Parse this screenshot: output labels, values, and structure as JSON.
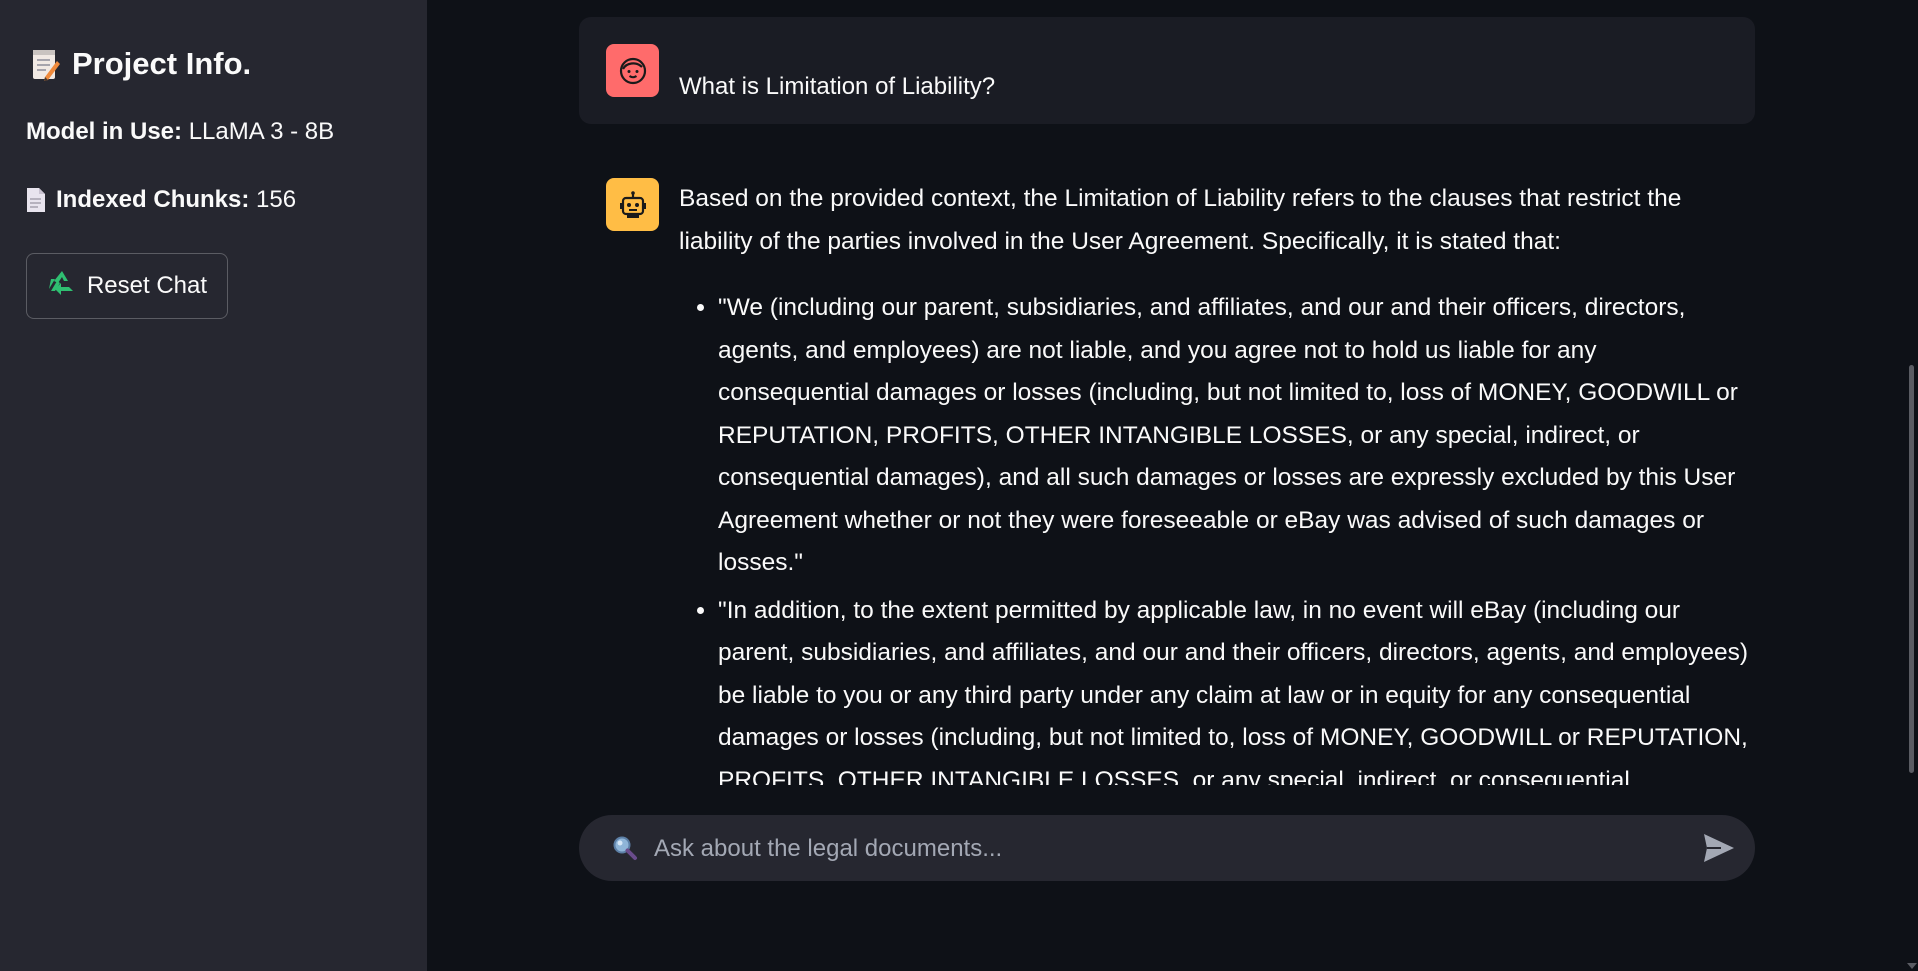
{
  "sidebar": {
    "title": "Project Info.",
    "title_icon": "memo-icon",
    "model_label": "Model in Use:",
    "model_value": "LLaMA 3 - 8B",
    "chunks_icon": "page-icon",
    "chunks_label": "Indexed Chunks:",
    "chunks_value": "156",
    "reset_icon": "recycle-icon",
    "reset_label": "Reset Chat"
  },
  "chat": {
    "messages": [
      {
        "role": "user",
        "avatar_icon": "user-face-icon",
        "avatar_color": "#ff6b6b",
        "text": "What is Limitation of Liability?"
      },
      {
        "role": "assistant",
        "avatar_icon": "robot-icon",
        "avatar_color": "#ffbd45",
        "intro": "Based on the provided context, the Limitation of Liability refers to the clauses that restrict the liability of the parties involved in the User Agreement. Specifically, it is stated that:",
        "bullets": [
          "\"We (including our parent, subsidiaries, and affiliates, and our and their officers, directors, agents, and employees) are not liable, and you agree not to hold us liable for any consequential damages or losses (including, but not limited to, loss of MONEY, GOODWILL or REPUTATION, PROFITS, OTHER INTANGIBLE LOSSES, or any special, indirect, or consequential damages), and all such damages or losses are expressly excluded by this User Agreement whether or not they were foreseeable or eBay was advised of such damages or losses.\"",
          "\"In addition, to the extent permitted by applicable law, in no event will eBay (including our parent, subsidiaries, and affiliates, and our and their officers, directors, agents, and employees) be liable to you or any third party under any claim at law or in equity for any consequential damages or losses (including, but not limited to, loss of MONEY, GOODWILL or REPUTATION, PROFITS, OTHER INTANGIBLE LOSSES, or any special, indirect, or consequential damages).\""
        ]
      }
    ]
  },
  "input": {
    "icon": "search-icon",
    "placeholder": "Ask about the legal documents...",
    "value": "",
    "send_icon": "send-icon"
  },
  "colors": {
    "background": "#0e1117",
    "sidebar": "#262730",
    "user_bubble": "#1a1c24",
    "user_avatar": "#ff6b6b",
    "bot_avatar": "#ffbd45"
  }
}
